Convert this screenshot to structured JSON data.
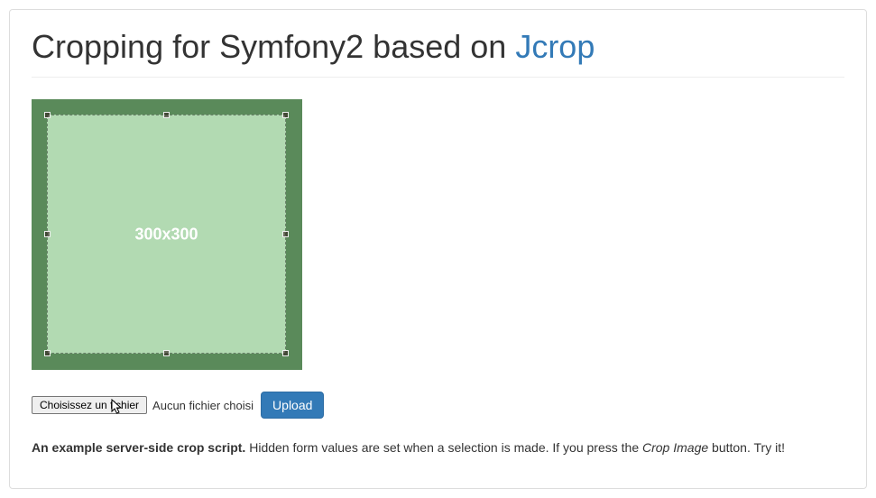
{
  "header": {
    "title_prefix": "Cropping for Symfony2 based on ",
    "title_link": "Jcrop"
  },
  "crop": {
    "placeholder": "300x300"
  },
  "controls": {
    "file_button_label": "Choisissez un fichier",
    "file_status": "Aucun fichier choisi",
    "upload_label": "Upload"
  },
  "description": {
    "strong": "An example server-side crop script.",
    "text": " Hidden form values are set when a selection is made. If you press the ",
    "em": "Crop Image",
    "tail": " button. Try it!"
  }
}
